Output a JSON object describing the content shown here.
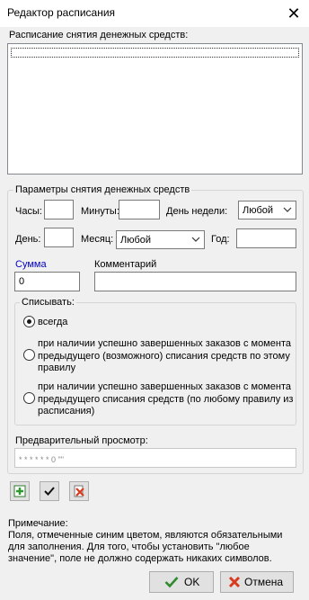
{
  "window": {
    "title": "Редактор расписания",
    "close_glyph": "✕"
  },
  "schedule": {
    "label": "Расписание снятия денежных средств:",
    "items": []
  },
  "params": {
    "group_title": "Параметры снятия денежных средств",
    "hours_label": "Часы:",
    "hours_value": "",
    "minutes_label": "Минуты:",
    "minutes_value": "",
    "weekday_label": "День недели:",
    "weekday_value": "Любой",
    "day_label": "День:",
    "day_value": "",
    "month_label": "Месяц:",
    "month_value": "Любой",
    "year_label": "Год:",
    "year_value": "",
    "sum_label": "Сумма",
    "sum_value": "0",
    "comment_label": "Комментарий",
    "comment_value": "",
    "write_off": {
      "group_title": "Списывать:",
      "options": [
        {
          "label": "всегда",
          "checked": true
        },
        {
          "label": "при наличии успешно завершенных заказов с момента предыдущего (возможного) списания средств по этому правилу",
          "checked": false
        },
        {
          "label": "при наличии успешно завершенных заказов с момента предыдущего списания средств (по любому правилу из расписания)",
          "checked": false
        }
      ]
    },
    "preview_label": "Предварительный просмотр:",
    "preview_value": "* * * * * * 0 \"\""
  },
  "toolbar": {
    "add_icon": "add-icon",
    "apply_icon": "checkmark-icon",
    "delete_icon": "delete-icon"
  },
  "note": {
    "title": "Примечание:",
    "lines": [
      "Поля, отмеченные синим цветом, являются обязательными",
      "для заполнения. Для того, чтобы установить \"любое",
      "значение\", поле не должно содержать никаких символов."
    ]
  },
  "buttons": {
    "ok_label": "OK",
    "cancel_label": "Отмена"
  },
  "colors": {
    "required_label": "#0000cc",
    "ok_icon": "#2e8b2e",
    "cancel_icon": "#d93a1e"
  }
}
